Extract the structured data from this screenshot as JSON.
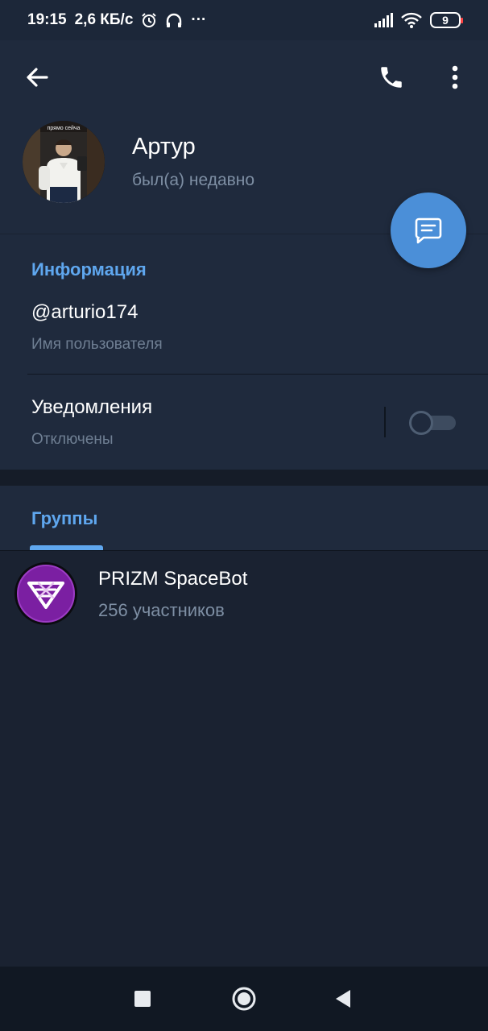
{
  "status_bar": {
    "time": "19:15",
    "speed": "2,6 КБ/с",
    "more": "···",
    "battery": "9",
    "icons": [
      "alarm-icon",
      "headphones-icon",
      "signal-icon",
      "wifi-icon",
      "battery-icon"
    ]
  },
  "header": {
    "back_icon": "arrow-left-icon",
    "call_icon": "phone-icon",
    "more_icon": "more-vertical-icon"
  },
  "profile": {
    "name": "Артур",
    "status": "был(а) недавно",
    "avatar_caption": "прямо сейча"
  },
  "fab": {
    "icon": "message-icon"
  },
  "info": {
    "title": "Информация",
    "username": "@arturio174",
    "username_label": "Имя пользователя",
    "notifications": "Уведомления",
    "notifications_state": "Отключены",
    "notifications_enabled": false
  },
  "groups": {
    "tab_label": "Группы",
    "items": [
      {
        "name": "PRIZM SpaceBot",
        "members": "256 участников"
      }
    ]
  },
  "colors": {
    "accent": "#5fa7ef",
    "fab": "#4b8fd8",
    "background": "#1a2231",
    "panel": "#1f2a3d",
    "group_avatar": "#7b1fa2"
  }
}
